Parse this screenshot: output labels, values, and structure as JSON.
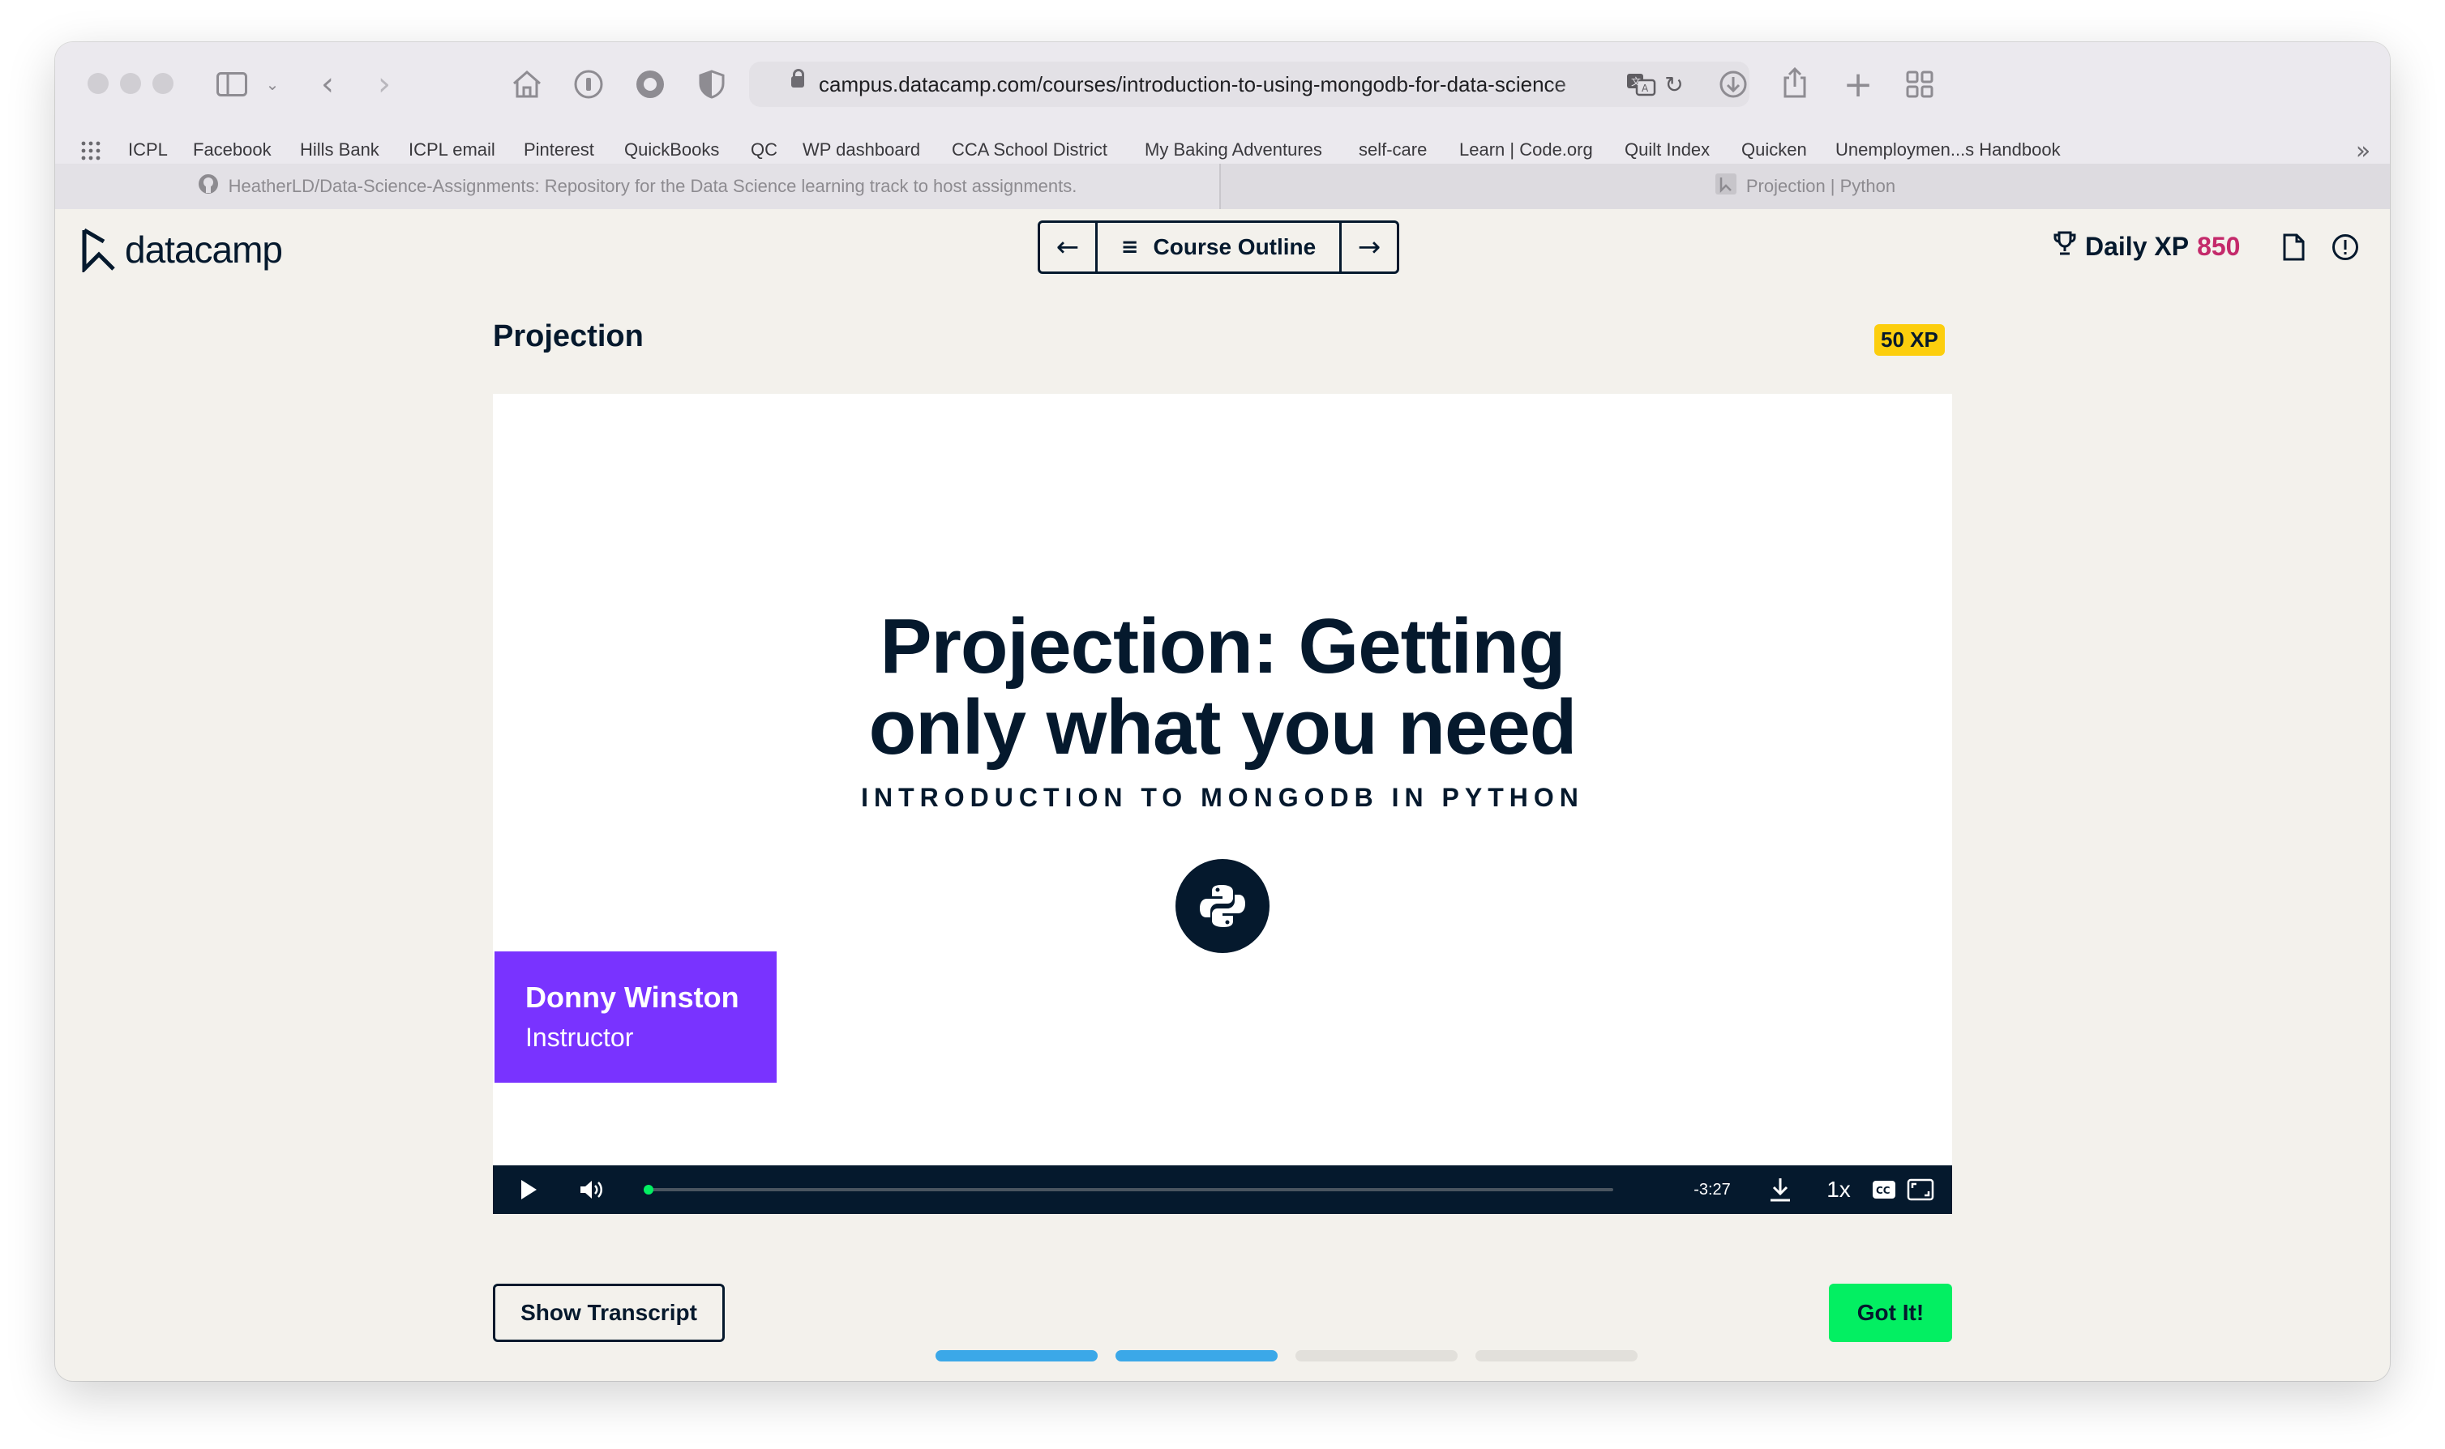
{
  "browser": {
    "url": "campus.datacamp.com/courses/introduction-to-using-mongodb-for-data-science",
    "bookmarks": [
      "ICPL",
      "Facebook",
      "Hills Bank",
      "ICPL email",
      "Pinterest",
      "QuickBooks",
      "QC",
      "WP dashboard",
      "CCA School District",
      "My Baking Adventures",
      "self-care",
      "Learn | Code.org",
      "Quilt Index",
      "Quicken",
      "Unemploymen...s Handbook"
    ],
    "tabs": [
      {
        "title": "HeatherLD/Data-Science-Assignments: Repository for the Data Science learning track to host assignments."
      },
      {
        "title": "Projection | Python"
      }
    ]
  },
  "header": {
    "logo": "datacamp",
    "course_outline": "Course Outline",
    "daily_xp_label": "Daily XP",
    "daily_xp_value": "850"
  },
  "exercise": {
    "title": "Projection",
    "xp_badge": "50 XP"
  },
  "video": {
    "title_line1": "Projection: Getting",
    "title_line2": "only what you need",
    "subtitle": "INTRODUCTION TO MONGODB IN PYTHON",
    "instructor_name": "Donny Winston",
    "instructor_role": "Instructor",
    "time_remaining": "-3:27",
    "speed": "1x",
    "progress_fraction": 0.0
  },
  "actions": {
    "show_transcript": "Show Transcript",
    "got_it": "Got It!"
  },
  "lesson_progress": {
    "segments_total": 4,
    "segments_done": 2
  },
  "colors": {
    "brand_navy": "#05192d",
    "xp_pink": "#c42a6b",
    "xp_badge_yellow": "#fcce0d",
    "instructor_purple": "#7933ff",
    "got_it_green": "#03ef62",
    "progress_blue": "#3ba8e8",
    "progress_grey": "#e2e0db"
  }
}
